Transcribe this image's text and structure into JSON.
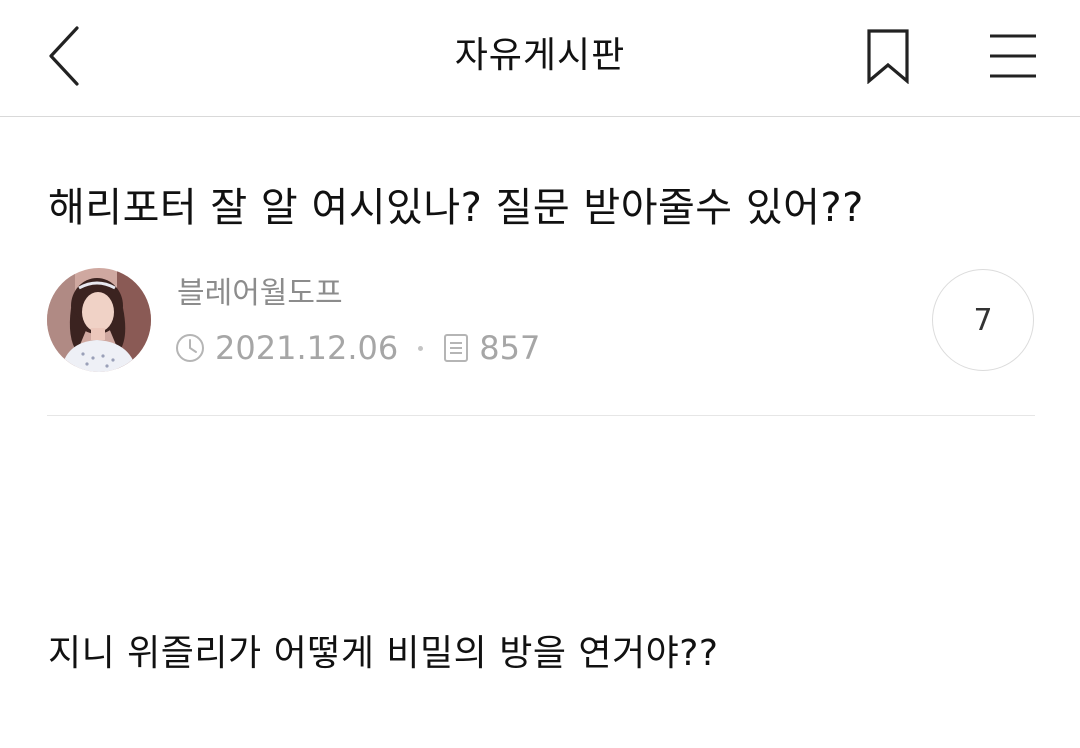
{
  "header": {
    "title": "자유게시판",
    "back_icon": "chevron-left-icon",
    "bookmark_icon": "bookmark-icon",
    "menu_icon": "hamburger-menu-icon"
  },
  "post": {
    "title": "해리포터 잘 알 여시있나? 질문 받아줄수 있어??",
    "author": "블레어월도프",
    "date": "2021.12.06",
    "views": "857",
    "comment_count": "7",
    "body": "지니 위즐리가 어떻게 비밀의 방을 연거야??"
  },
  "colors": {
    "text": "#111111",
    "meta": "#a6a6a6",
    "author": "#8c8c8c",
    "divider": "#e6e6e6"
  }
}
